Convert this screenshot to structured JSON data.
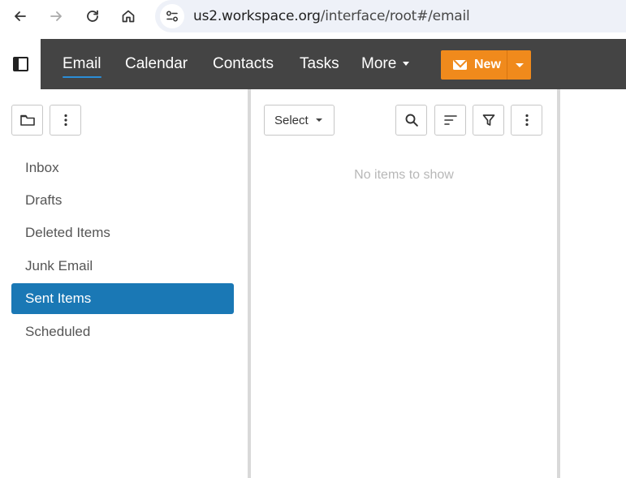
{
  "browser": {
    "url_host": "us2.workspace.org",
    "url_path": "/interface/root#/email"
  },
  "app_nav": {
    "items": [
      {
        "label": "Email",
        "active": true
      },
      {
        "label": "Calendar"
      },
      {
        "label": "Contacts"
      },
      {
        "label": "Tasks"
      },
      {
        "label": "More"
      }
    ],
    "new_label": "New",
    "accent_color": "#f08a1c",
    "header_color": "#444444"
  },
  "folders": {
    "items": [
      {
        "label": "Inbox"
      },
      {
        "label": "Drafts"
      },
      {
        "label": "Deleted Items"
      },
      {
        "label": "Junk Email"
      },
      {
        "label": "Sent Items",
        "selected": true
      },
      {
        "label": "Scheduled"
      }
    ],
    "selected_color": "#1a78b5"
  },
  "list": {
    "select_label": "Select",
    "empty_message": "No items to show"
  }
}
